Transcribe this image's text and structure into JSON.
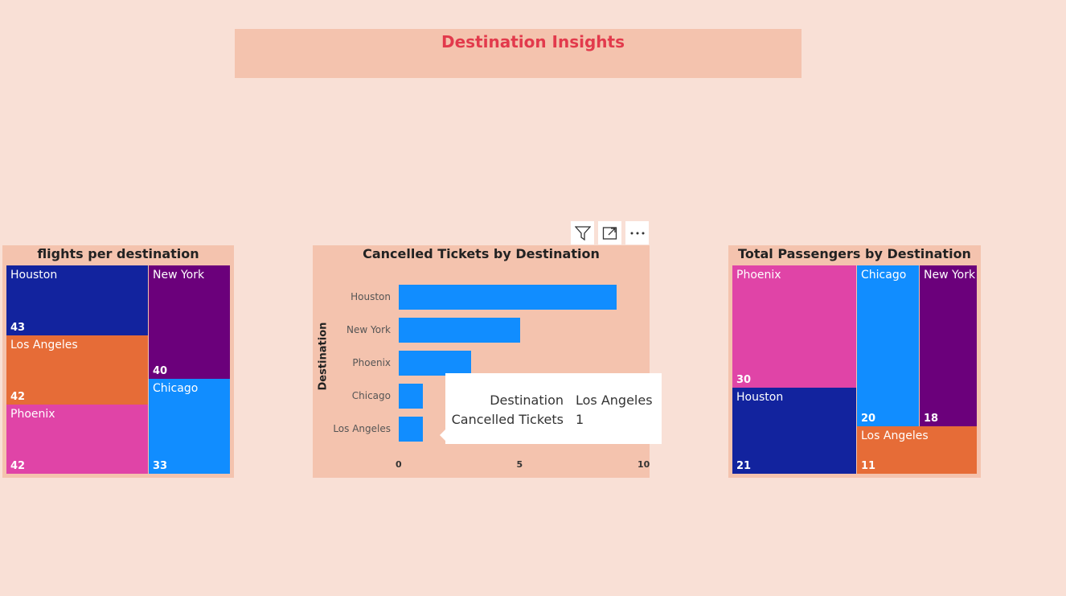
{
  "page": {
    "title": "Destination Insights",
    "title_color": "#e23a4c"
  },
  "colors": {
    "panel_bg": "#f4c3ae",
    "Houston": "#12239e",
    "New York": "#6b007b",
    "Los Angeles": "#e66c37",
    "Phoenix": "#e044a7",
    "Chicago": "#118dff",
    "bar": "#118dff"
  },
  "toolbar": {
    "icons": [
      "filter-icon",
      "focus-mode-icon",
      "more-options-icon"
    ]
  },
  "chart_data": [
    {
      "type": "treemap",
      "title": "flights per destination",
      "categories": [
        "Houston",
        "New York",
        "Los Angeles",
        "Phoenix",
        "Chicago"
      ],
      "values": [
        43,
        40,
        42,
        42,
        33
      ]
    },
    {
      "type": "bar",
      "orientation": "horizontal",
      "title": "Cancelled Tickets by Destination",
      "ylabel": "Destination",
      "xlabel": "",
      "categories": [
        "Houston",
        "New York",
        "Phoenix",
        "Chicago",
        "Los Angeles"
      ],
      "values": [
        9,
        5,
        3,
        1,
        1
      ],
      "xlim": [
        0,
        10
      ],
      "xticks": [
        "0",
        "5",
        "10"
      ],
      "tooltip": {
        "rows": [
          {
            "label": "Destination",
            "value": "Los Angeles"
          },
          {
            "label": "Cancelled Tickets",
            "value": "1"
          }
        ]
      }
    },
    {
      "type": "treemap",
      "title": "Total Passengers by Destination",
      "categories": [
        "Phoenix",
        "Chicago",
        "New York",
        "Houston",
        "Los Angeles"
      ],
      "values": [
        30,
        20,
        18,
        21,
        11
      ]
    }
  ]
}
